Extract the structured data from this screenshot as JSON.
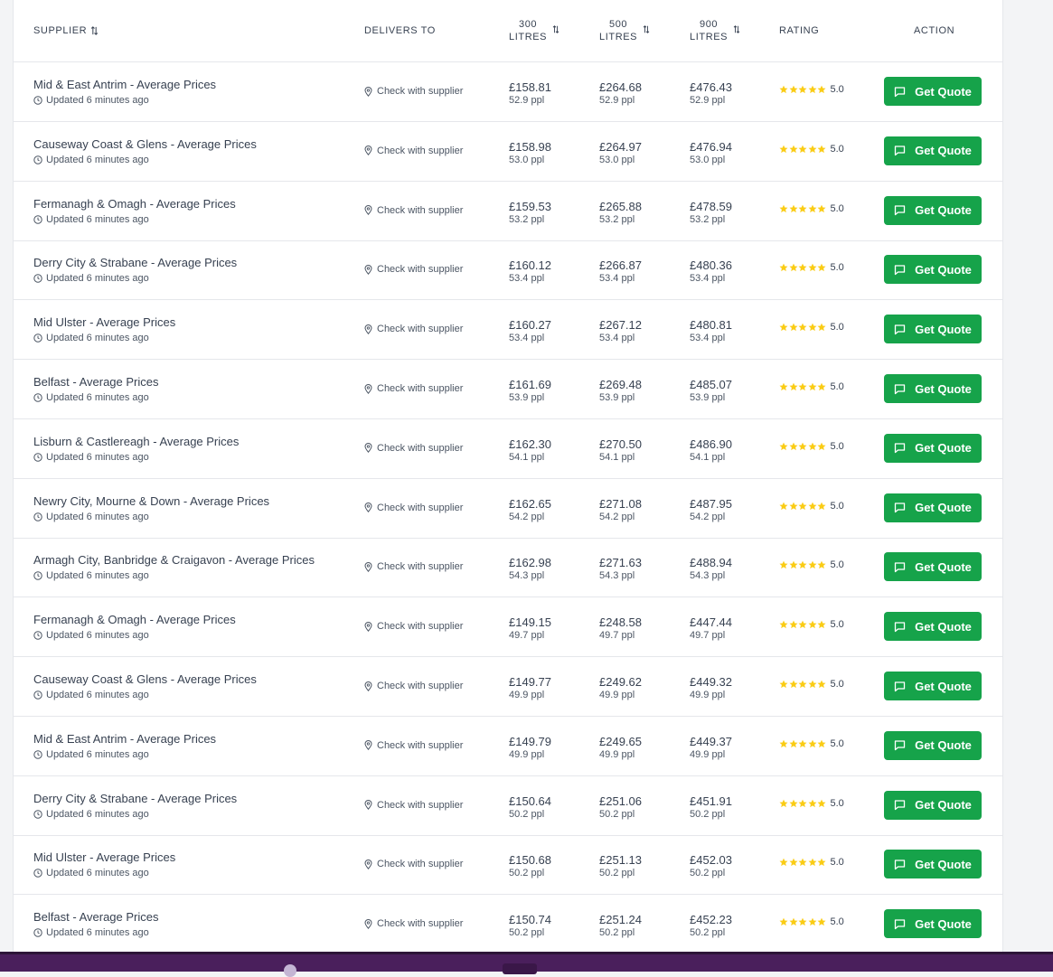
{
  "table": {
    "headers": {
      "supplier": "SUPPLIER",
      "delivers_to": "DELIVERS TO",
      "col300_top": "300",
      "col300_bottom": "LITRES",
      "col500_top": "500",
      "col500_bottom": "LITRES",
      "col900_top": "900",
      "col900_bottom": "LITRES",
      "rating": "RATING",
      "action": "ACTION"
    },
    "rows": [
      {
        "supplier": "Mid & East Antrim - Average Prices",
        "updated": "Updated 6 minutes ago",
        "delivers": "Check with supplier",
        "p300": "£158.81",
        "ppl300": "52.9 ppl",
        "p500": "£264.68",
        "ppl500": "52.9 ppl",
        "p900": "£476.43",
        "ppl900": "52.9 ppl",
        "rating": "5.0",
        "action": "Get Quote"
      },
      {
        "supplier": "Causeway Coast & Glens - Average Prices",
        "updated": "Updated 6 minutes ago",
        "delivers": "Check with supplier",
        "p300": "£158.98",
        "ppl300": "53.0 ppl",
        "p500": "£264.97",
        "ppl500": "53.0 ppl",
        "p900": "£476.94",
        "ppl900": "53.0 ppl",
        "rating": "5.0",
        "action": "Get Quote"
      },
      {
        "supplier": "Fermanagh & Omagh - Average Prices",
        "updated": "Updated 6 minutes ago",
        "delivers": "Check with supplier",
        "p300": "£159.53",
        "ppl300": "53.2 ppl",
        "p500": "£265.88",
        "ppl500": "53.2 ppl",
        "p900": "£478.59",
        "ppl900": "53.2 ppl",
        "rating": "5.0",
        "action": "Get Quote"
      },
      {
        "supplier": "Derry City & Strabane - Average Prices",
        "updated": "Updated 6 minutes ago",
        "delivers": "Check with supplier",
        "p300": "£160.12",
        "ppl300": "53.4 ppl",
        "p500": "£266.87",
        "ppl500": "53.4 ppl",
        "p900": "£480.36",
        "ppl900": "53.4 ppl",
        "rating": "5.0",
        "action": "Get Quote"
      },
      {
        "supplier": "Mid Ulster - Average Prices",
        "updated": "Updated 6 minutes ago",
        "delivers": "Check with supplier",
        "p300": "£160.27",
        "ppl300": "53.4 ppl",
        "p500": "£267.12",
        "ppl500": "53.4 ppl",
        "p900": "£480.81",
        "ppl900": "53.4 ppl",
        "rating": "5.0",
        "action": "Get Quote"
      },
      {
        "supplier": "Belfast - Average Prices",
        "updated": "Updated 6 minutes ago",
        "delivers": "Check with supplier",
        "p300": "£161.69",
        "ppl300": "53.9 ppl",
        "p500": "£269.48",
        "ppl500": "53.9 ppl",
        "p900": "£485.07",
        "ppl900": "53.9 ppl",
        "rating": "5.0",
        "action": "Get Quote"
      },
      {
        "supplier": "Lisburn & Castlereagh - Average Prices",
        "updated": "Updated 6 minutes ago",
        "delivers": "Check with supplier",
        "p300": "£162.30",
        "ppl300": "54.1 ppl",
        "p500": "£270.50",
        "ppl500": "54.1 ppl",
        "p900": "£486.90",
        "ppl900": "54.1 ppl",
        "rating": "5.0",
        "action": "Get Quote"
      },
      {
        "supplier": "Newry City, Mourne & Down - Average Prices",
        "updated": "Updated 6 minutes ago",
        "delivers": "Check with supplier",
        "p300": "£162.65",
        "ppl300": "54.2 ppl",
        "p500": "£271.08",
        "ppl500": "54.2 ppl",
        "p900": "£487.95",
        "ppl900": "54.2 ppl",
        "rating": "5.0",
        "action": "Get Quote"
      },
      {
        "supplier": "Armagh City, Banbridge & Craigavon - Average Prices",
        "updated": "Updated 6 minutes ago",
        "delivers": "Check with supplier",
        "p300": "£162.98",
        "ppl300": "54.3 ppl",
        "p500": "£271.63",
        "ppl500": "54.3 ppl",
        "p900": "£488.94",
        "ppl900": "54.3 ppl",
        "rating": "5.0",
        "action": "Get Quote"
      },
      {
        "supplier": "Fermanagh & Omagh - Average Prices",
        "updated": "Updated 6 minutes ago",
        "delivers": "Check with supplier",
        "p300": "£149.15",
        "ppl300": "49.7 ppl",
        "p500": "£248.58",
        "ppl500": "49.7 ppl",
        "p900": "£447.44",
        "ppl900": "49.7 ppl",
        "rating": "5.0",
        "action": "Get Quote"
      },
      {
        "supplier": "Causeway Coast & Glens - Average Prices",
        "updated": "Updated 6 minutes ago",
        "delivers": "Check with supplier",
        "p300": "£149.77",
        "ppl300": "49.9 ppl",
        "p500": "£249.62",
        "ppl500": "49.9 ppl",
        "p900": "£449.32",
        "ppl900": "49.9 ppl",
        "rating": "5.0",
        "action": "Get Quote"
      },
      {
        "supplier": "Mid & East Antrim - Average Prices",
        "updated": "Updated 6 minutes ago",
        "delivers": "Check with supplier",
        "p300": "£149.79",
        "ppl300": "49.9 ppl",
        "p500": "£249.65",
        "ppl500": "49.9 ppl",
        "p900": "£449.37",
        "ppl900": "49.9 ppl",
        "rating": "5.0",
        "action": "Get Quote"
      },
      {
        "supplier": "Derry City & Strabane - Average Prices",
        "updated": "Updated 6 minutes ago",
        "delivers": "Check with supplier",
        "p300": "£150.64",
        "ppl300": "50.2 ppl",
        "p500": "£251.06",
        "ppl500": "50.2 ppl",
        "p900": "£451.91",
        "ppl900": "50.2 ppl",
        "rating": "5.0",
        "action": "Get Quote"
      },
      {
        "supplier": "Mid Ulster - Average Prices",
        "updated": "Updated 6 minutes ago",
        "delivers": "Check with supplier",
        "p300": "£150.68",
        "ppl300": "50.2 ppl",
        "p500": "£251.13",
        "ppl500": "50.2 ppl",
        "p900": "£452.03",
        "ppl900": "50.2 ppl",
        "rating": "5.0",
        "action": "Get Quote"
      },
      {
        "supplier": "Belfast - Average Prices",
        "updated": "Updated 6 minutes ago",
        "delivers": "Check with supplier",
        "p300": "£150.74",
        "ppl300": "50.2 ppl",
        "p500": "£251.24",
        "ppl500": "50.2 ppl",
        "p900": "£452.23",
        "ppl900": "50.2 ppl",
        "rating": "5.0",
        "action": "Get Quote"
      }
    ]
  },
  "icons": {
    "sort": "sort-arrows-icon",
    "clock": "clock-icon",
    "location": "map-pin-icon",
    "star": "star-icon",
    "chat": "chat-bubble-icon"
  },
  "colors": {
    "accent_green": "#16a34a",
    "star_yellow": "#facc15",
    "taskbar": "#4a1f5c"
  }
}
